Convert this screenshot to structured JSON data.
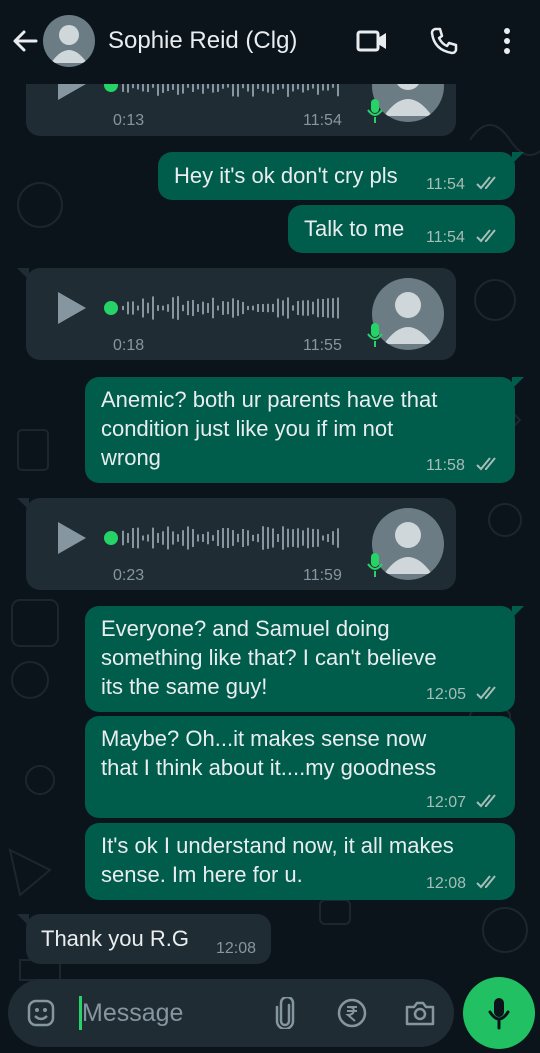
{
  "header": {
    "contact_name": "Sophie Reid (Clg)",
    "icons": [
      "back-arrow-icon",
      "avatar",
      "video-call-icon",
      "phone-icon",
      "more-options-icon"
    ]
  },
  "messages": [
    {
      "type": "voice",
      "direction": "in",
      "duration": "0:13",
      "time": "11:54"
    },
    {
      "type": "text",
      "direction": "out",
      "text": "Hey it's ok don't cry pls",
      "time": "11:54",
      "status": "read"
    },
    {
      "type": "text",
      "direction": "out",
      "text": "Talk to me",
      "time": "11:54",
      "status": "read"
    },
    {
      "type": "voice",
      "direction": "in",
      "duration": "0:18",
      "time": "11:55"
    },
    {
      "type": "text",
      "direction": "out",
      "lines": [
        "Anemic? both ur parents have that",
        "condition just like you if im not",
        "wrong"
      ],
      "time": "11:58",
      "status": "read"
    },
    {
      "type": "voice",
      "direction": "in",
      "duration": "0:23",
      "time": "11:59"
    },
    {
      "type": "text",
      "direction": "out",
      "lines": [
        "Everyone? and Samuel doing",
        "something like that? I can't believe",
        "its the same guy!"
      ],
      "time": "12:05",
      "status": "read"
    },
    {
      "type": "text",
      "direction": "out",
      "lines": [
        "Maybe? Oh...it makes sense now",
        "that I think about it....my goodness"
      ],
      "time": "12:07",
      "status": "read"
    },
    {
      "type": "text",
      "direction": "out",
      "lines": [
        "It's ok I understand now, it all makes",
        "sense. Im here for u."
      ],
      "time": "12:08",
      "status": "read"
    },
    {
      "type": "text",
      "direction": "in",
      "text": "Thank you R.G",
      "time": "12:08"
    }
  ],
  "input": {
    "placeholder": "Message",
    "icons": [
      "emoji-icon",
      "attach-icon",
      "rupee-payment-icon",
      "camera-icon"
    ],
    "send_icon": "mic-icon"
  },
  "colors": {
    "background": "#0b141a",
    "outgoing": "#005c4b",
    "incoming": "#202c33",
    "accent": "#21c063"
  }
}
